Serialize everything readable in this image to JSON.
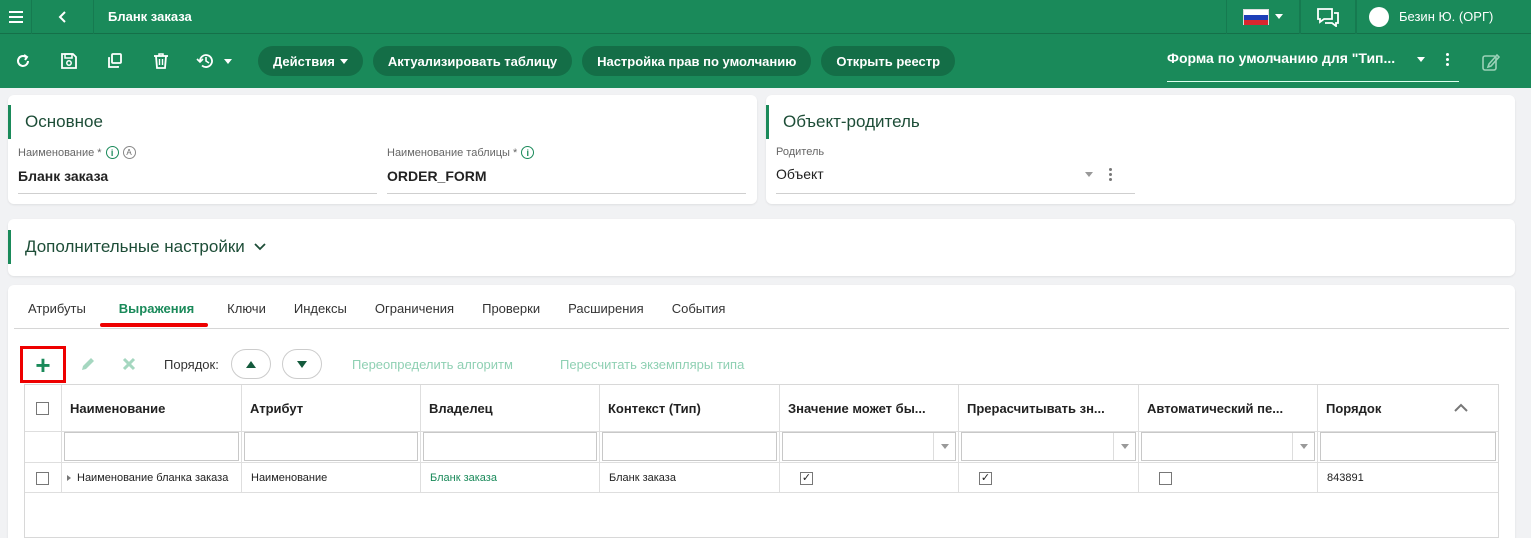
{
  "app": {
    "title": "Бланк заказа",
    "user_name": "Безин Ю. (ОРГ)",
    "accent": "#1a8a5a",
    "accent_dark": "#146e47"
  },
  "toolbar": {
    "icons": [
      "refresh-icon",
      "save-icon",
      "copy-icon",
      "delete-icon",
      "history-icon"
    ],
    "actions_label": "Действия",
    "refresh_table_label": "Актуализировать таблицу",
    "default_rights_label": "Настройка прав по умолчанию",
    "open_registry_label": "Открыть реестр",
    "form_selector": "Форма по умолчанию для \"Тип..."
  },
  "main_section": {
    "title": "Основное",
    "name_label": "Наименование *",
    "name_value": "Бланк заказа",
    "table_name_label": "Наименование таблицы *",
    "table_name_value": "ORDER_FORM"
  },
  "parent_section": {
    "title": "Объект-родитель",
    "parent_label": "Родитель",
    "parent_value": "Объект"
  },
  "extra_section": {
    "title": "Дополнительные настройки"
  },
  "tabs": [
    "Атрибуты",
    "Выражения",
    "Ключи",
    "Индексы",
    "Ограничения",
    "Проверки",
    "Расширения",
    "События"
  ],
  "active_tab": "Выражения",
  "grid_toolbar": {
    "order_label": "Порядок:",
    "override_algorithm": "Переопределить алгоритм",
    "recalculate_instances": "Пересчитать экземпляры типа"
  },
  "grid": {
    "columns": [
      "Наименование",
      "Атрибут",
      "Владелец",
      "Контекст (Тип)",
      "Значение может бы...",
      "Прерасчитывать зн...",
      "Автоматический пе...",
      "Порядок"
    ],
    "rows": [
      {
        "name": "Наименование бланка заказа",
        "attribute": "Наименование",
        "owner": "Бланк заказа",
        "context": "Бланк заказа",
        "value_can_be": true,
        "recalculate": true,
        "automatic": false,
        "order": "843891"
      }
    ]
  }
}
